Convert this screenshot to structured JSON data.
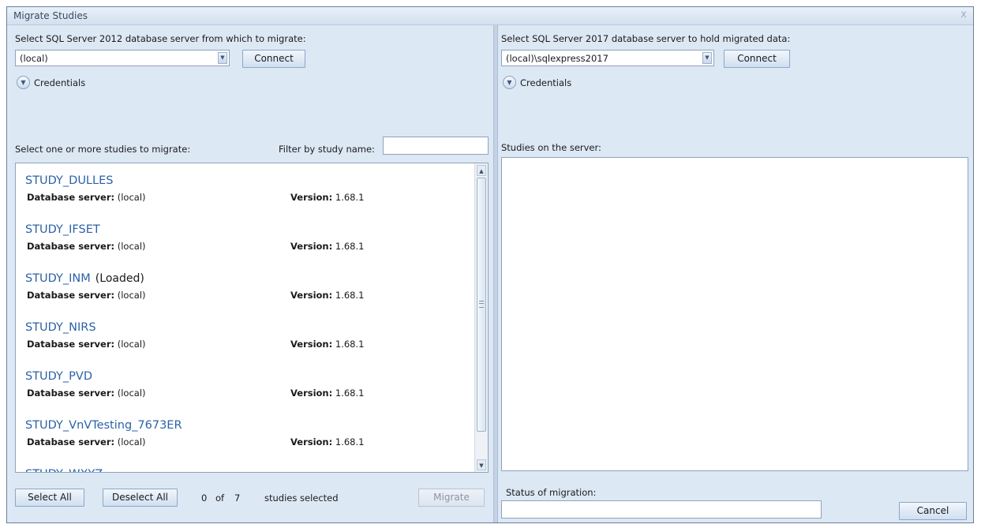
{
  "window": {
    "title": "Migrate Studies",
    "close_glyph": "x"
  },
  "source": {
    "server_label": "Select SQL Server 2012 database server from which to migrate:",
    "server_value": "(local)",
    "connect_label": "Connect",
    "credentials_label": "Credentials",
    "studies_label": "Select one or more studies to migrate:",
    "filter_label": "Filter by study name:",
    "filter_value": "",
    "studies": [
      {
        "name": "STUDY_DULLES",
        "loaded": "",
        "server_key": "Database server:",
        "server_val": "(local)",
        "version_key": "Version:",
        "version_val": "1.68.1"
      },
      {
        "name": "STUDY_IFSET",
        "loaded": "",
        "server_key": "Database server:",
        "server_val": "(local)",
        "version_key": "Version:",
        "version_val": "1.68.1"
      },
      {
        "name": "STUDY_INM",
        "loaded": "(Loaded)",
        "server_key": "Database server:",
        "server_val": "(local)",
        "version_key": "Version:",
        "version_val": "1.68.1"
      },
      {
        "name": "STUDY_NIRS",
        "loaded": "",
        "server_key": "Database server:",
        "server_val": "(local)",
        "version_key": "Version:",
        "version_val": "1.68.1"
      },
      {
        "name": "STUDY_PVD",
        "loaded": "",
        "server_key": "Database server:",
        "server_val": "(local)",
        "version_key": "Version:",
        "version_val": "1.68.1"
      },
      {
        "name": "STUDY_VnVTesting_7673ER",
        "loaded": "",
        "server_key": "Database server:",
        "server_val": "(local)",
        "version_key": "Version:",
        "version_val": "1.68.1"
      },
      {
        "name": "STUDY_WXYZ",
        "loaded": "",
        "server_key": "",
        "server_val": "",
        "version_key": "",
        "version_val": ""
      }
    ],
    "select_all_label": "Select All",
    "deselect_all_label": "Deselect All",
    "selected_count": "0",
    "of_label": "of",
    "total_count": "7",
    "studies_selected_label": "studies selected",
    "migrate_label": "Migrate"
  },
  "target": {
    "server_label": "Select SQL Server 2017 database server to hold migrated data:",
    "server_value": "(local)\\sqlexpress2017",
    "connect_label": "Connect",
    "credentials_label": "Credentials",
    "studies_label": "Studies on the  server:",
    "status_label": "Status of migration:",
    "status_value": "",
    "cancel_label": "Cancel"
  },
  "icons": {
    "dropdown": "chevron-down-icon",
    "expander": "chevron-down-circle-icon",
    "scroll_up": "triangle-up-icon",
    "scroll_down": "triangle-down-icon"
  }
}
